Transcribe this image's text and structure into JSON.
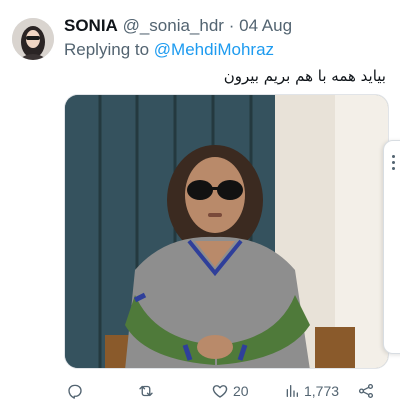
{
  "tweet": {
    "display_name": "SONIA",
    "handle": "@_sonia_hdr",
    "separator": "·",
    "date": "04 Aug",
    "replying_prefix": "Replying to",
    "replying_to": "@MehdiMohraz",
    "text": "بیاید همه با هم بریم بیرون"
  },
  "actions": {
    "reply_count": "",
    "retweet_count": "",
    "like_count": "20",
    "views_count": "1,773"
  },
  "icons": {
    "reply": "reply-icon",
    "retweet": "retweet-icon",
    "like": "heart-icon",
    "views": "views-icon",
    "share": "share-icon",
    "more": "more-dots-icon"
  },
  "colors": {
    "link": "#1d9bf0",
    "secondary_text": "#536471",
    "primary_text": "#0f1419"
  }
}
